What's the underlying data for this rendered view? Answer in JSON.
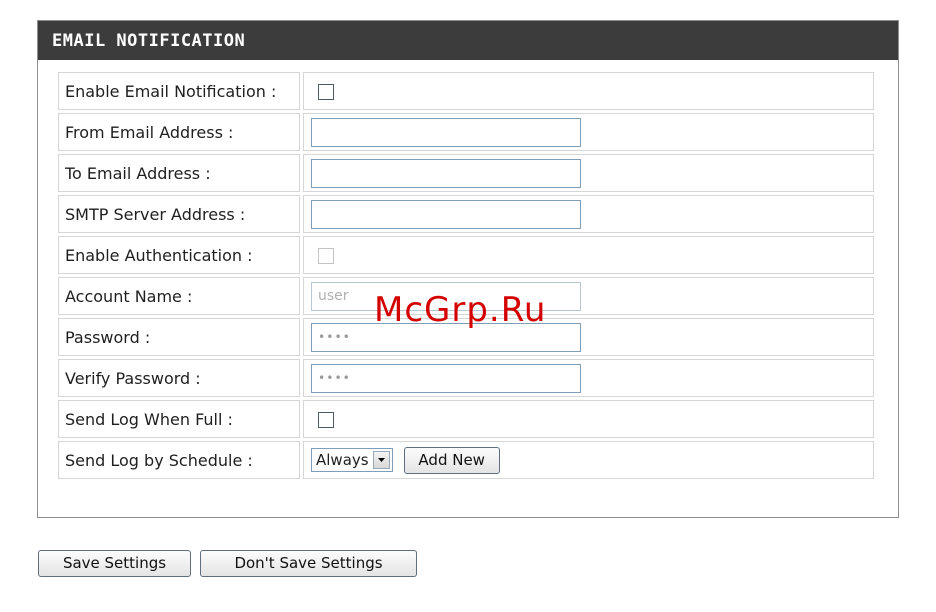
{
  "panel": {
    "title": "EMAIL NOTIFICATION"
  },
  "form": {
    "enable_email_notification": {
      "label": "Enable Email Notification :",
      "checked": false
    },
    "from_email": {
      "label": "From Email Address :",
      "value": ""
    },
    "to_email": {
      "label": "To Email Address :",
      "value": ""
    },
    "smtp_server": {
      "label": "SMTP Server Address :",
      "value": ""
    },
    "enable_authentication": {
      "label": "Enable Authentication :",
      "checked": false
    },
    "account_name": {
      "label": "Account Name :",
      "value": "user"
    },
    "password": {
      "label": "Password :",
      "value": "••••"
    },
    "verify_password": {
      "label": "Verify Password :",
      "value": "••••"
    },
    "send_log_when_full": {
      "label": "Send Log When Full :",
      "checked": false
    },
    "send_log_by_schedule": {
      "label": "Send Log by Schedule :",
      "selected": "Always",
      "add_new_label": "Add New"
    }
  },
  "actions": {
    "save_label": "Save Settings",
    "dont_save_label": "Don't Save Settings"
  },
  "watermark": {
    "text": "McGrp.Ru",
    "color": "#d40000"
  },
  "icons": {
    "dropdown": "chevron-down-icon"
  }
}
